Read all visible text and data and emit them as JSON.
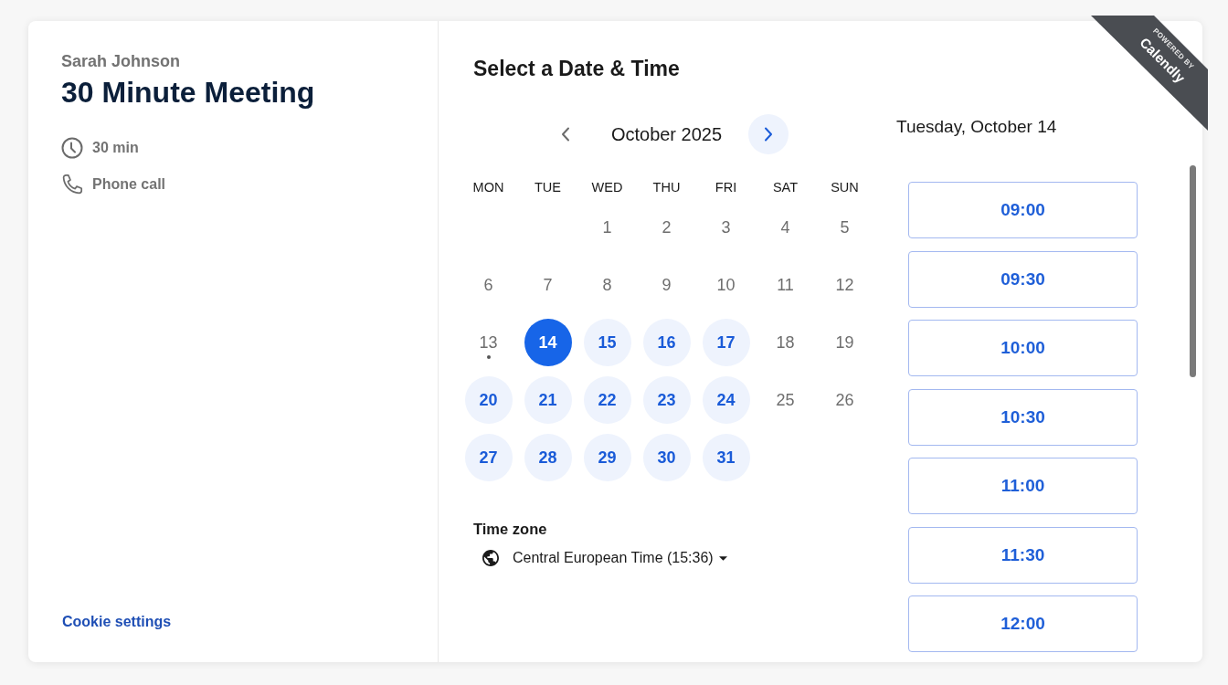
{
  "event_info": {
    "organizer": "Sarah Johnson",
    "title": "30 Minute Meeting",
    "details": [
      {
        "kind": "duration",
        "label": "30 min"
      },
      {
        "kind": "phone",
        "label": "Phone call"
      }
    ],
    "cookie_link": "Cookie settings"
  },
  "ribbon": {
    "caption": "POWERED BY",
    "brand": "Calendly"
  },
  "booking": {
    "title": "Select a Date & Time",
    "calendar": {
      "month": "October 2025",
      "previous": {
        "disabled": true
      },
      "next": {
        "disabled": false
      },
      "weekdays": [
        "MON",
        "TUE",
        "WED",
        "THU",
        "FRI",
        "SAT",
        "SUN"
      ],
      "weeks": [
        {
          "days": [
            {
              "label": "1",
              "available": false,
              "selected": false,
              "today": false
            },
            {
              "label": "2",
              "available": false,
              "selected": false,
              "today": false
            },
            {
              "label": "3",
              "available": false,
              "selected": false,
              "today": false
            },
            {
              "label": "4",
              "available": false,
              "selected": false,
              "today": false
            },
            {
              "label": "5",
              "available": false,
              "selected": false,
              "today": false
            }
          ]
        },
        {
          "days": [
            {
              "label": "6",
              "available": false,
              "selected": false,
              "today": false
            },
            {
              "label": "7",
              "available": false,
              "selected": false,
              "today": false
            },
            {
              "label": "8",
              "available": false,
              "selected": false,
              "today": false
            },
            {
              "label": "9",
              "available": false,
              "selected": false,
              "today": false
            },
            {
              "label": "10",
              "available": false,
              "selected": false,
              "today": false
            },
            {
              "label": "11",
              "available": false,
              "selected": false,
              "today": false
            },
            {
              "label": "12",
              "available": false,
              "selected": false,
              "today": false
            }
          ]
        },
        {
          "days": [
            {
              "label": "13",
              "available": false,
              "selected": false,
              "today": true
            },
            {
              "label": "14",
              "available": true,
              "selected": true,
              "today": false
            },
            {
              "label": "15",
              "available": true,
              "selected": false,
              "today": false
            },
            {
              "label": "16",
              "available": true,
              "selected": false,
              "today": false
            },
            {
              "label": "17",
              "available": true,
              "selected": false,
              "today": false
            },
            {
              "label": "18",
              "available": false,
              "selected": false,
              "today": false
            },
            {
              "label": "19",
              "available": false,
              "selected": false,
              "today": false
            }
          ]
        },
        {
          "days": [
            {
              "label": "20",
              "available": true,
              "selected": false,
              "today": false
            },
            {
              "label": "21",
              "available": true,
              "selected": false,
              "today": false
            },
            {
              "label": "22",
              "available": true,
              "selected": false,
              "today": false
            },
            {
              "label": "23",
              "available": true,
              "selected": false,
              "today": false
            },
            {
              "label": "24",
              "available": true,
              "selected": false,
              "today": false
            },
            {
              "label": "25",
              "available": false,
              "selected": false,
              "today": false
            },
            {
              "label": "26",
              "available": false,
              "selected": false,
              "today": false
            }
          ]
        },
        {
          "days": [
            {
              "label": "27",
              "available": true,
              "selected": false,
              "today": false
            },
            {
              "label": "28",
              "available": true,
              "selected": false,
              "today": false
            },
            {
              "label": "29",
              "available": true,
              "selected": false,
              "today": false
            },
            {
              "label": "30",
              "available": true,
              "selected": false,
              "today": false
            },
            {
              "label": "31",
              "available": true,
              "selected": false,
              "today": false
            }
          ]
        }
      ]
    },
    "timezone": {
      "label": "Time zone",
      "value": "Central European Time (15:36)"
    },
    "selected_date": "Tuesday, October 14",
    "time_slots": [
      "09:00",
      "09:30",
      "10:00",
      "10:30",
      "11:00",
      "11:30",
      "12:00"
    ]
  }
}
